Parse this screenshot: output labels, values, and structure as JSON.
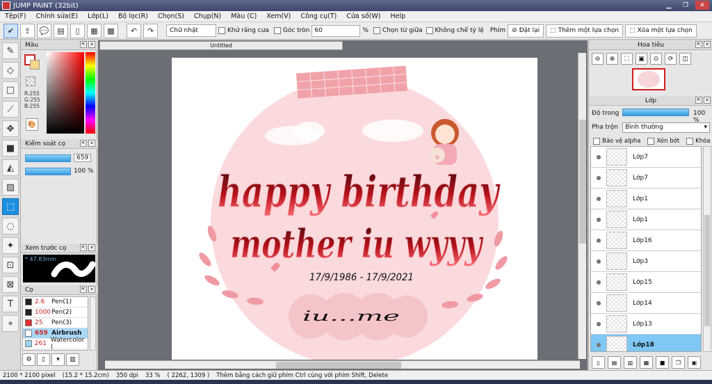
{
  "window": {
    "title": "JUMP PAINT (32bit)"
  },
  "menu": [
    "Tệp(F)",
    "Chỉnh sửa(E)",
    "Lớp(L)",
    "Bộ lọc(R)",
    "Chọn(S)",
    "Chụp(N)",
    "Màu (C)",
    "Xem(V)",
    "Công cụ(T)",
    "Cửa số(W)",
    "Help"
  ],
  "toolbar": {
    "shape_select": "Chữ nhật",
    "antialias_label": "Khử răng cưa",
    "round_corner_label": "Góc tròn",
    "round_corner_value": "60",
    "percent": "%",
    "from_center_label": "Chọn từ giữa",
    "fixed_ratio_label": "Không chế tỷ lệ",
    "key_label": "Phím",
    "reset_label": "Đặt lại",
    "add_selection_label": "Thêm một lựa chọn",
    "remove_selection_label": "Xóa một lựa chọn"
  },
  "color_panel": {
    "title": "Màu",
    "r": "R:255",
    "g": "G:255",
    "b": "B:255"
  },
  "brush_control": {
    "title": "Kiểm soát cọ",
    "size": "659",
    "opacity": "100 %",
    "size_fraction": 1.0,
    "opacity_fraction": 1.0
  },
  "brush_preview": {
    "title": "Xem trước cọ",
    "size_text": "47.83mm"
  },
  "brush_list": {
    "title": "Cọ",
    "items": [
      {
        "num": "2.6",
        "name": "Pen(1)",
        "color": "#222222"
      },
      {
        "num": "1000",
        "name": "Pen(2)",
        "color": "#222222"
      },
      {
        "num": "25",
        "name": "Pen(3)",
        "color": "#e03030"
      },
      {
        "num": "659",
        "name": "Airbrush",
        "color": "#ffffff",
        "selected": true
      },
      {
        "num": "261",
        "name": "Watercolor (",
        "color": "#9bd6f0"
      }
    ]
  },
  "document": {
    "tab": "Untitled"
  },
  "artwork": {
    "line1": "happy birthday",
    "line2": "mother iu wyyy",
    "dates": "17/9/1986 - 17/9/2021",
    "signature": "iu...me"
  },
  "navigator": {
    "title": "Hoa tiêu"
  },
  "layers": {
    "title": "Lớp",
    "opacity_label": "Độ trong",
    "opacity_value": "100 %",
    "opacity_fraction": 1.0,
    "blend_label": "Pha trộn",
    "blend_value": "Bình thường",
    "protect_alpha": "Bảo vệ alpha",
    "clip": "Xén bớt",
    "lock": "Khóa",
    "items": [
      {
        "name": "Lớp7"
      },
      {
        "name": "Lớp7"
      },
      {
        "name": "Lớp1"
      },
      {
        "name": "Lớp1"
      },
      {
        "name": "Lớp16"
      },
      {
        "name": "Lớp3"
      },
      {
        "name": "Lớp15"
      },
      {
        "name": "Lớp14"
      },
      {
        "name": "Lớp13"
      },
      {
        "name": "Lớp18",
        "selected": true
      }
    ]
  },
  "status": {
    "size": "2100 * 2100 pixel",
    "cm": "(15.2 * 15.2cm)",
    "dpi": "350 dpi",
    "zoom": "33 %",
    "coords": "( 2262, 1309 )",
    "hint": "Thêm bằng cách giữ phím Ctrl cùng với phím Shift, Delete"
  }
}
